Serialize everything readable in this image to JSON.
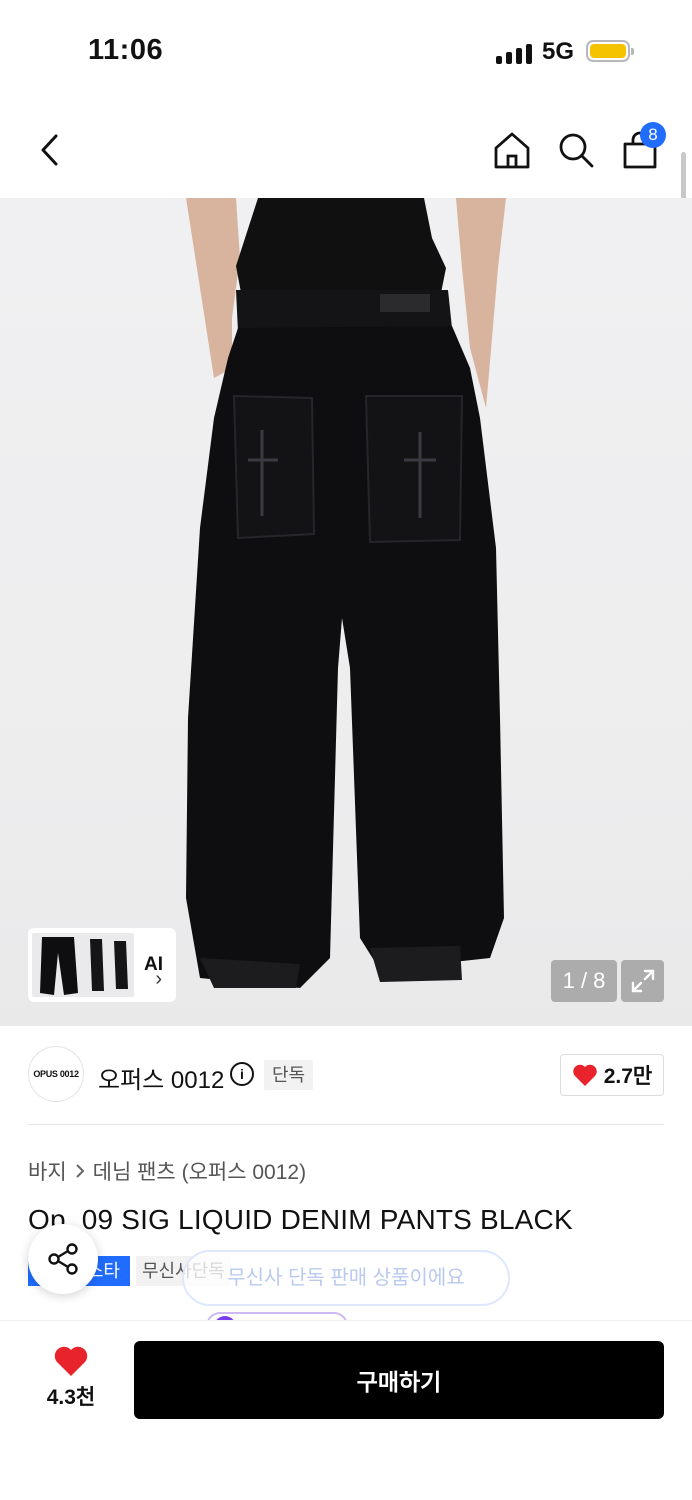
{
  "status_bar": {
    "time": "11:06",
    "network": "5G",
    "battery_color": "#f4c400"
  },
  "nav": {
    "cart_count": "8",
    "icons": [
      "back-icon",
      "home-icon",
      "search-icon",
      "shopping-bag-icon"
    ]
  },
  "gallery": {
    "ai_label": "AI",
    "page_counter": "1 / 8",
    "current_page": 1,
    "total_pages": 8
  },
  "brand": {
    "logo_text": "OPUS 0012",
    "name": "오퍼스 0012",
    "exclusive_tag": "단독",
    "likes": "2.7만",
    "accent": "#e8232b"
  },
  "breadcrumb": [
    "바지",
    "데님 팬츠 (오퍼스 0012)"
  ],
  "product": {
    "title": "Op. 09 SIG LIQUID DENIM PANTS BLACK"
  },
  "tags": {
    "blue": "스타",
    "gray": "무신사단독",
    "blue_color": "#1f6cff"
  },
  "toast": {
    "message": "무신사 단독 판매 상품이에요"
  },
  "bottom_bar": {
    "wish_count": "4.3천",
    "buy_label": "구매하기"
  }
}
